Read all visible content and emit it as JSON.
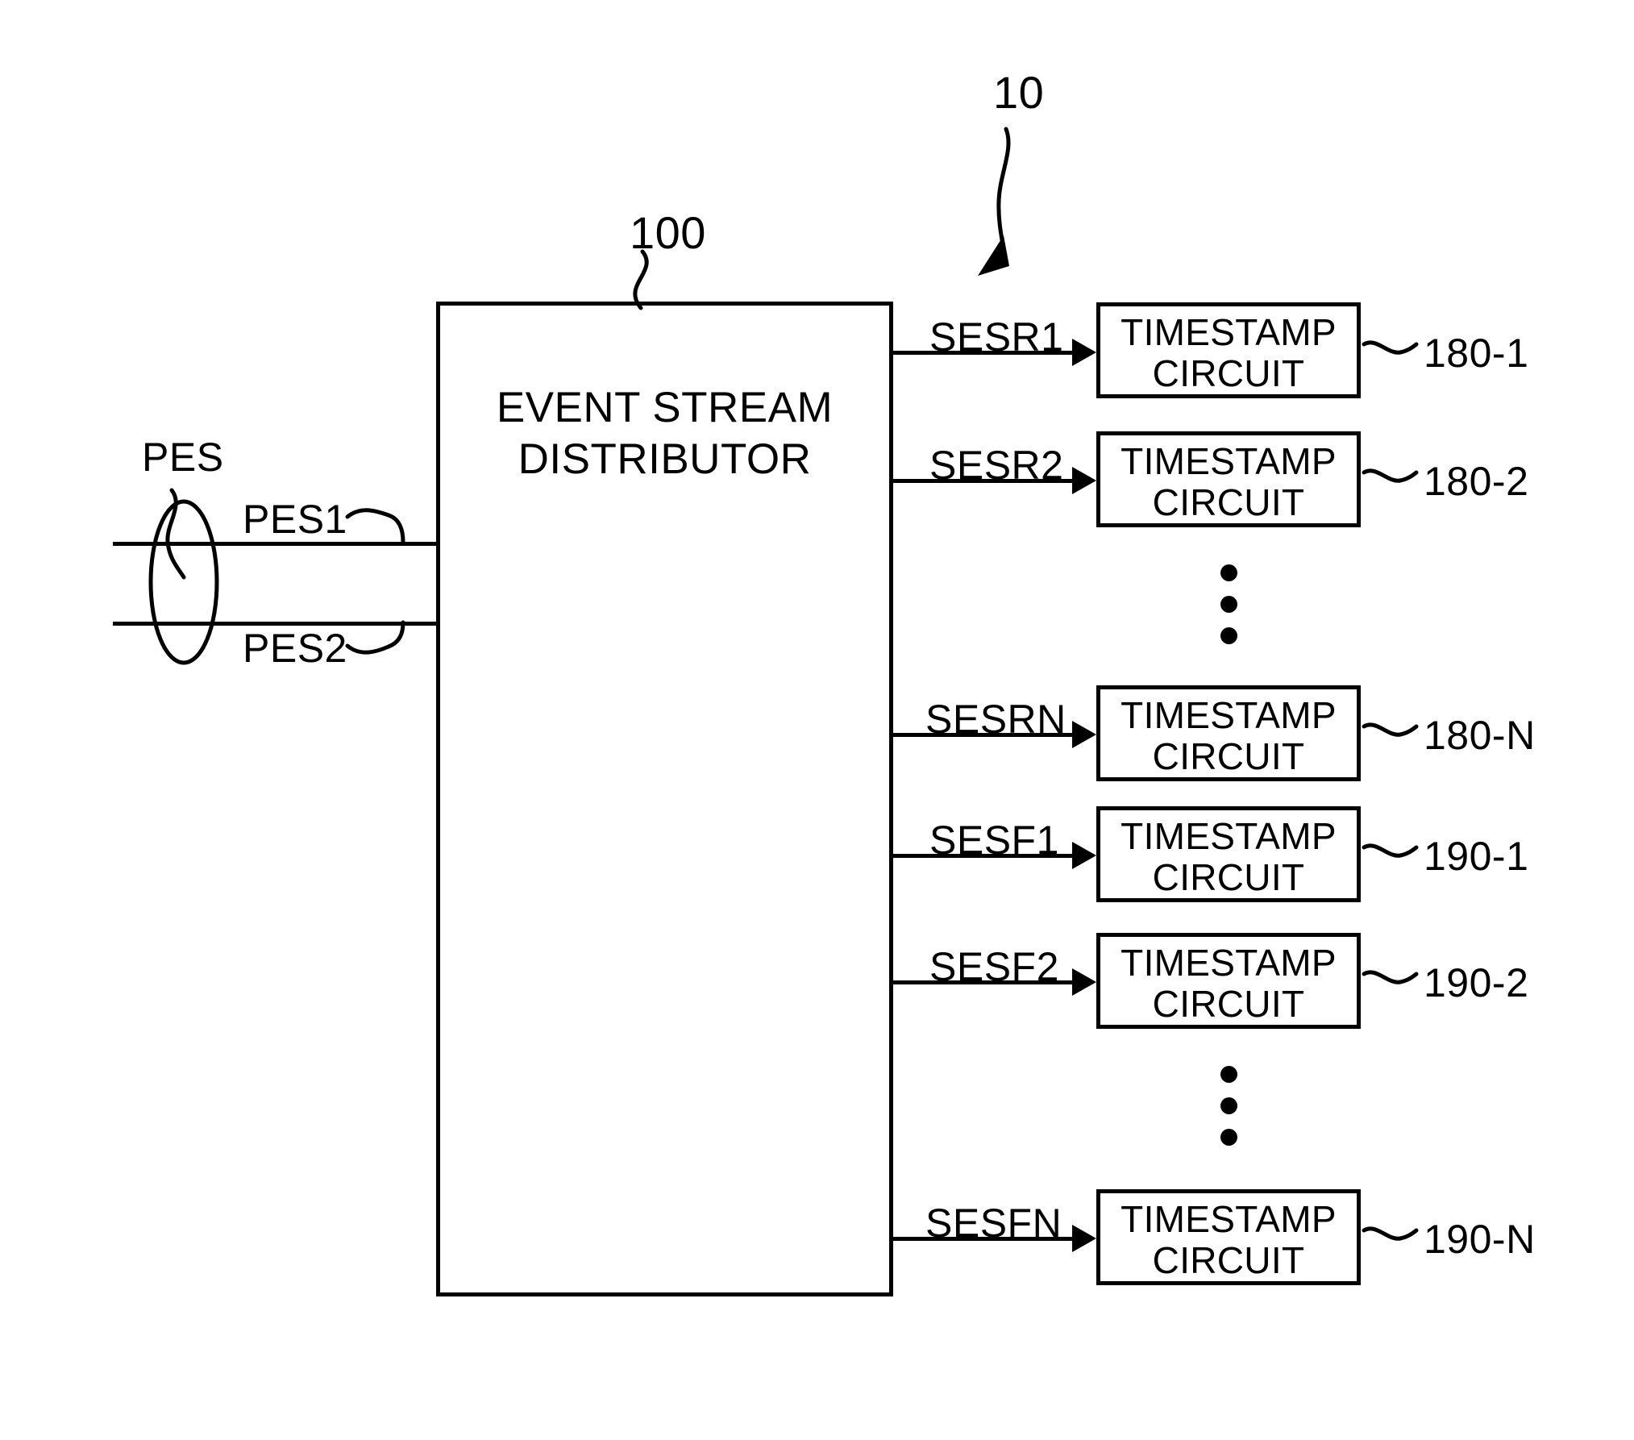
{
  "figure": {
    "system_ref": "10",
    "distributor": {
      "ref": "100",
      "label_line1": "EVENT STREAM",
      "label_line2": "DISTRIBUTOR"
    },
    "inputs": {
      "bundle_label": "PES",
      "signals": [
        {
          "name": "PES1"
        },
        {
          "name": "PES2"
        }
      ]
    },
    "outputs": {
      "rise_group": [
        {
          "signal": "SESR1",
          "block_line1": "TIMESTAMP",
          "block_line2": "CIRCUIT",
          "ref": "180-1"
        },
        {
          "signal": "SESR2",
          "block_line1": "TIMESTAMP",
          "block_line2": "CIRCUIT",
          "ref": "180-2"
        },
        {
          "signal": "SESRN",
          "block_line1": "TIMESTAMP",
          "block_line2": "CIRCUIT",
          "ref": "180-N"
        }
      ],
      "fall_group": [
        {
          "signal": "SESF1",
          "block_line1": "TIMESTAMP",
          "block_line2": "CIRCUIT",
          "ref": "190-1"
        },
        {
          "signal": "SESF2",
          "block_line1": "TIMESTAMP",
          "block_line2": "CIRCUIT",
          "ref": "190-2"
        },
        {
          "signal": "SESFN",
          "block_line1": "TIMESTAMP",
          "block_line2": "CIRCUIT",
          "ref": "190-N"
        }
      ]
    },
    "ellipsis_marks": [
      {
        "name": "vertical-ellipsis-rise"
      },
      {
        "name": "vertical-ellipsis-fall"
      }
    ],
    "colors": {
      "ink": "#000000",
      "background": "#ffffff"
    }
  }
}
